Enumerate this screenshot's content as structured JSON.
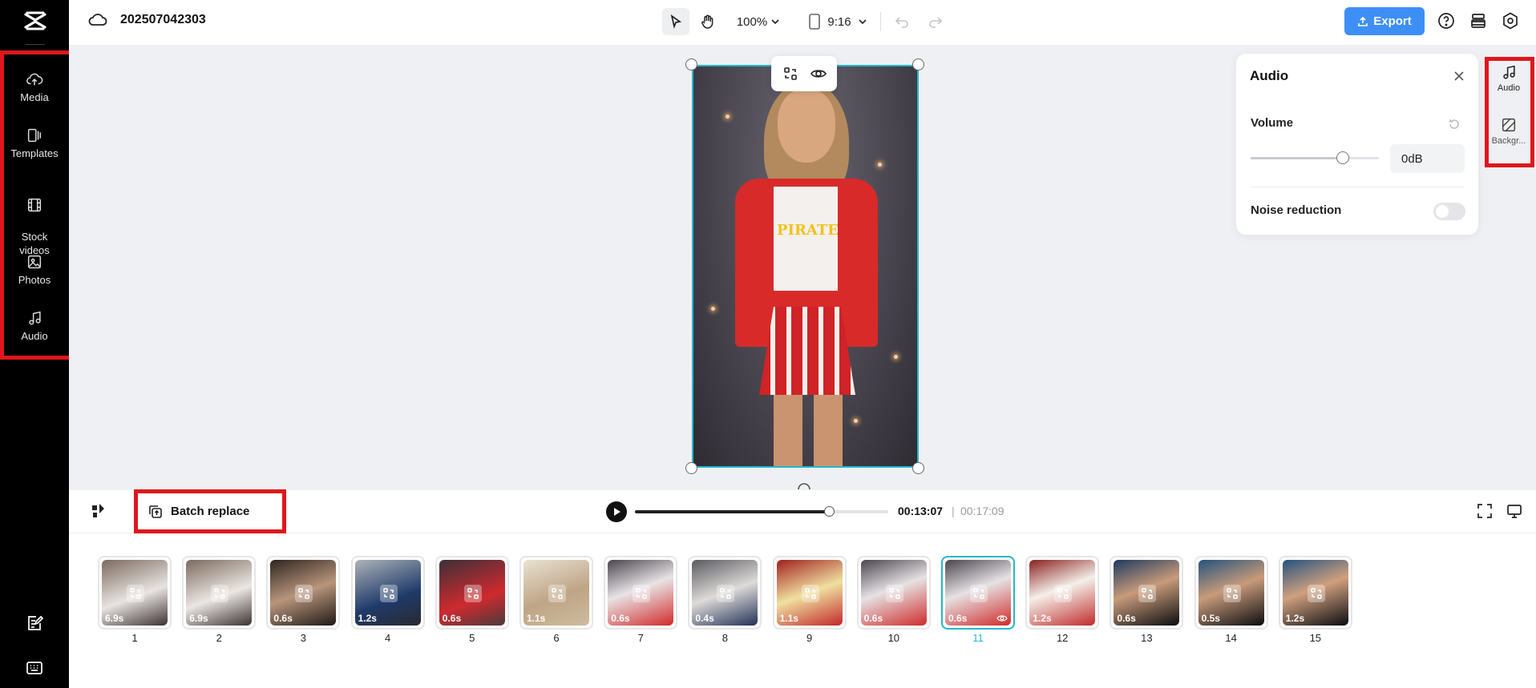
{
  "header": {
    "project_title": "202507042303",
    "zoom_label": "100%",
    "aspect_label": "9:16",
    "export_label": "Export"
  },
  "sidebar": {
    "items": [
      {
        "label": "Media",
        "icon": "cloud-upload-icon"
      },
      {
        "label": "Templates",
        "icon": "templates-icon"
      },
      {
        "label": "Stock\nvideos",
        "icon": "film-icon"
      },
      {
        "label": "Photos",
        "icon": "image-icon"
      },
      {
        "label": "Audio",
        "icon": "music-note-icon"
      }
    ]
  },
  "audio_panel": {
    "title": "Audio",
    "volume_label": "Volume",
    "volume_value": "0dB",
    "volume_level": 0.72,
    "noise_label": "Noise reduction",
    "noise_on": false
  },
  "right_tabs": [
    {
      "label": "Audio",
      "icon": "music-note-icon"
    },
    {
      "label": "Backgr...",
      "icon": "background-icon"
    }
  ],
  "playback": {
    "batch_label": "Batch replace",
    "current_time": "00:13:07",
    "separator": "|",
    "total_time": "00:17:09",
    "progress": 0.765
  },
  "clips": [
    {
      "num": "1",
      "dur": "6.9s"
    },
    {
      "num": "2",
      "dur": "6.9s"
    },
    {
      "num": "3",
      "dur": "0.6s"
    },
    {
      "num": "4",
      "dur": "1.2s"
    },
    {
      "num": "5",
      "dur": "0.6s"
    },
    {
      "num": "6",
      "dur": "1.1s"
    },
    {
      "num": "7",
      "dur": "0.6s"
    },
    {
      "num": "8",
      "dur": "0.4s"
    },
    {
      "num": "9",
      "dur": "1.1s"
    },
    {
      "num": "10",
      "dur": "0.6s"
    },
    {
      "num": "11",
      "dur": "0.6s"
    },
    {
      "num": "12",
      "dur": "1.2s"
    },
    {
      "num": "13",
      "dur": "0.6s"
    },
    {
      "num": "14",
      "dur": "0.5s"
    },
    {
      "num": "15",
      "dur": "1.2s"
    }
  ],
  "selected_clip": "11",
  "colors": {
    "accent": "#23b8c8",
    "export": "#3d8ff6",
    "highlight": "#e0161c"
  },
  "video_text": "PIRATE"
}
